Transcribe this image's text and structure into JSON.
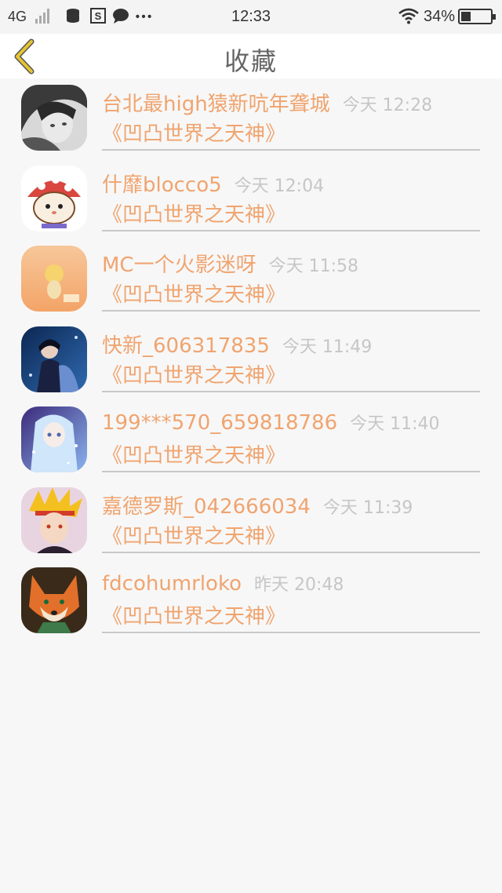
{
  "status_bar": {
    "network": "4G",
    "time": "12:33",
    "battery": "34%"
  },
  "header": {
    "title": "收藏"
  },
  "favorites": [
    {
      "user": "台北最high猿新吭年聋城",
      "time": "今天 12:28",
      "game": "《凹凸世界之天神》",
      "avatar": "avatar-girl-bw"
    },
    {
      "user": "什靡blocco5",
      "time": "今天 12:04",
      "game": "《凹凸世界之天神》",
      "avatar": "avatar-hamster-mushroom"
    },
    {
      "user": "MC一个火影迷呀",
      "time": "今天 11:58",
      "game": "《凹凸世界之天神》",
      "avatar": "avatar-chibi-orange"
    },
    {
      "user": "快新_606317835",
      "time": "今天 11:49",
      "game": "《凹凸世界之天神》",
      "avatar": "avatar-couple-night"
    },
    {
      "user": "199***570_659818786",
      "time": "今天 11:40",
      "game": "《凹凸世界之天神》",
      "avatar": "avatar-anime-blue-hair"
    },
    {
      "user": "嘉德罗斯_042666034",
      "time": "今天 11:39",
      "game": "《凹凸世界之天神》",
      "avatar": "avatar-anime-yellow-hair"
    },
    {
      "user": "fdcohumrloko",
      "time": "昨天 20:48",
      "game": "《凹凸世界之天神》",
      "avatar": "avatar-fox"
    }
  ],
  "colors": {
    "accent": "#f0a46f",
    "timestamp": "#c6c6c6",
    "background": "#f7f7f7",
    "back_arrow": "#e6c430"
  }
}
